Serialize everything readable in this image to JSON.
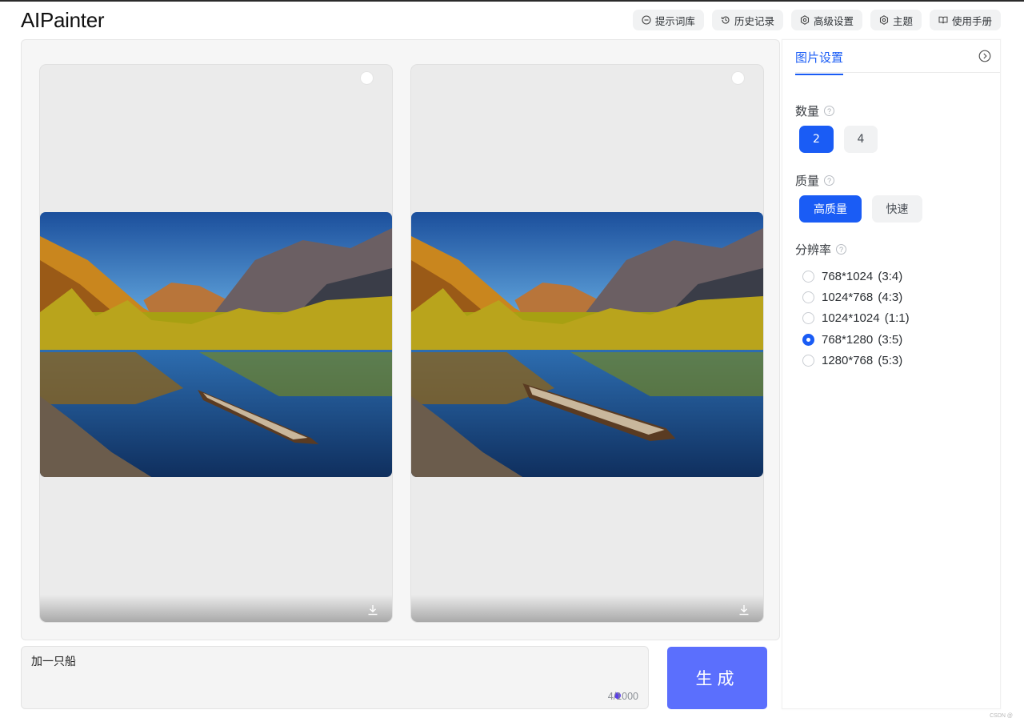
{
  "app": {
    "title": "AIPainter"
  },
  "nav": [
    {
      "label": "提示词库",
      "icon": "library-icon"
    },
    {
      "label": "历史记录",
      "icon": "history-icon"
    },
    {
      "label": "高级设置",
      "icon": "gear-icon"
    },
    {
      "label": "主题",
      "icon": "theme-gear-icon"
    },
    {
      "label": "使用手册",
      "icon": "book-icon"
    }
  ],
  "gallery": {
    "images": [
      {
        "subject": "mountain lake with boat",
        "selected": false
      },
      {
        "subject": "mountain lake with boat",
        "selected": false
      }
    ]
  },
  "prompt": {
    "value": "加一只船",
    "counter": "4/1000"
  },
  "generate": {
    "label": "生成"
  },
  "settings": {
    "tab": "图片设置",
    "quantity": {
      "label": "数量",
      "options": [
        "2",
        "4"
      ],
      "selected": "2"
    },
    "quality": {
      "label": "质量",
      "options": [
        "高质量",
        "快速"
      ],
      "selected": "高质量"
    },
    "resolution": {
      "label": "分辨率",
      "options": [
        "768*1024 (3:4)",
        "1024*768 (4:3)",
        "1024*1024 (1:1)",
        "768*1280 (3:5)",
        "1280*768 (5:3)"
      ],
      "selected": "768*1280 (3:5)"
    }
  },
  "colors": {
    "primary": "#1a5cf5",
    "generate": "#5b6ffd"
  },
  "watermark": "CSDN @"
}
